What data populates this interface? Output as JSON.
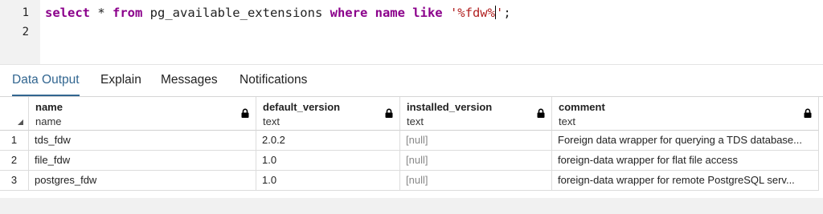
{
  "editor": {
    "line_numbers": [
      "1",
      "2"
    ],
    "query": {
      "kw_select": "select",
      "star": " * ",
      "kw_from": "from",
      "table": " pg_available_extensions ",
      "kw_where": "where",
      "column": " name ",
      "kw_like": "like",
      "space": " ",
      "string_before_cursor": "'%fdw%",
      "string_after_cursor": "'",
      "semicolon": ";"
    }
  },
  "tabs": [
    {
      "label": "Data Output",
      "active": true
    },
    {
      "label": "Explain"
    },
    {
      "label": "Messages"
    },
    {
      "label": "Notifications"
    }
  ],
  "grid": {
    "columns": [
      {
        "name": "name",
        "type": "name"
      },
      {
        "name": "default_version",
        "type": "text"
      },
      {
        "name": "installed_version",
        "type": "text"
      },
      {
        "name": "comment",
        "type": "text"
      }
    ],
    "rows": [
      {
        "num": "1",
        "name": "tds_fdw",
        "default_version": "2.0.2",
        "installed_version": "[null]",
        "comment": "Foreign data wrapper for querying a TDS database..."
      },
      {
        "num": "2",
        "name": "file_fdw",
        "default_version": "1.0",
        "installed_version": "[null]",
        "comment": "foreign-data wrapper for flat file access"
      },
      {
        "num": "3",
        "name": "postgres_fdw",
        "default_version": "1.0",
        "installed_version": "[null]",
        "comment": "foreign-data wrapper for remote PostgreSQL serv..."
      }
    ]
  }
}
